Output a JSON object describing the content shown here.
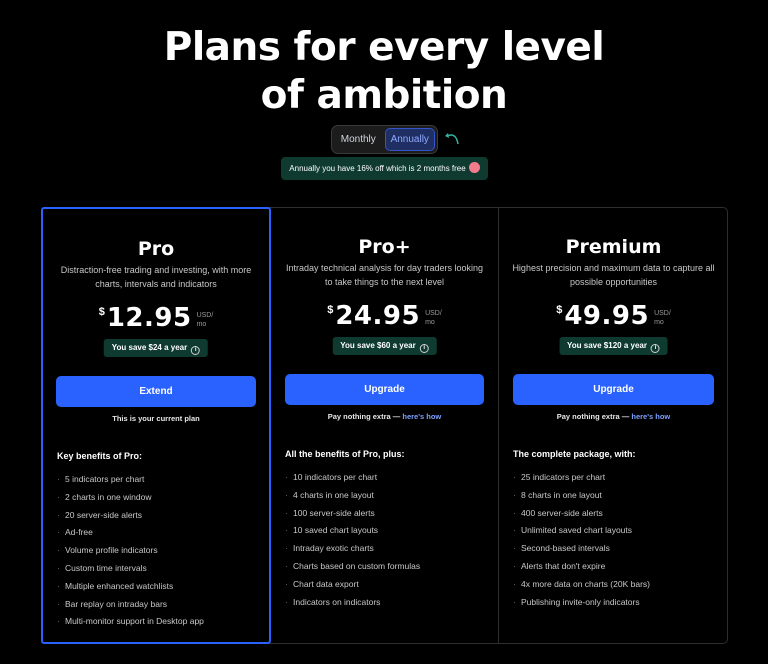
{
  "headline": [
    "Plans for every level",
    "of ambition"
  ],
  "billing_toggle": {
    "monthly": "Monthly",
    "annually": "Annually",
    "selected": "Annually"
  },
  "save_banner": "Annually you have 16% off which is 2 months free",
  "plans": [
    {
      "name": "Pro",
      "description": "Distraction-free trading and investing, with more charts, intervals and indicators",
      "currency": "$",
      "price": "12.95",
      "per_top": "USD/",
      "per_bottom": "mo",
      "you_save": "You save $24 a year",
      "cta": "Extend",
      "note": "This is your current plan",
      "benefits_title": "Key benefits of Pro:",
      "benefits": [
        "5 indicators per chart",
        "2 charts in one window",
        "20 server-side alerts",
        "Ad-free",
        "Volume profile indicators",
        "Custom time intervals",
        "Multiple enhanced watchlists",
        "Bar replay on intraday bars",
        "Multi-monitor support in Desktop app"
      ]
    },
    {
      "name": "Pro+",
      "description": "Intraday technical analysis for day traders looking to take things to the next level",
      "currency": "$",
      "price": "24.95",
      "per_top": "USD/",
      "per_bottom": "mo",
      "you_save": "You save $60 a year",
      "cta": "Upgrade",
      "note": "Pay nothing extra —",
      "note_link": "here's how",
      "benefits_title": "All the benefits of Pro, plus:",
      "benefits": [
        "10 indicators per chart",
        "4 charts in one layout",
        "100 server-side alerts",
        "10 saved chart layouts",
        "Intraday exotic charts",
        "Charts based on custom formulas",
        "Chart data export",
        "Indicators on indicators"
      ]
    },
    {
      "name": "Premium",
      "description": "Highest precision and maximum data to capture all possible opportunities",
      "currency": "$",
      "price": "49.95",
      "per_top": "USD/",
      "per_bottom": "mo",
      "you_save": "You save $120 a year",
      "cta": "Upgrade",
      "note": "Pay nothing extra —",
      "note_link": "here's how",
      "benefits_title": "The complete package, with:",
      "benefits": [
        "25 indicators per chart",
        "8 charts in one layout",
        "400 server-side alerts",
        "Unlimited saved chart layouts",
        "Second-based intervals",
        "Alerts that don't expire",
        "4x more data on charts (20K bars)",
        "Publishing invite-only indicators"
      ]
    }
  ],
  "icons": {
    "arrow": "curved-arrow-icon",
    "emoji": "heart-eyes-emoji-icon",
    "info": "info-icon"
  },
  "colors": {
    "accent": "#2962ff",
    "save_bg": "#0f3a30",
    "background": "#000000"
  }
}
